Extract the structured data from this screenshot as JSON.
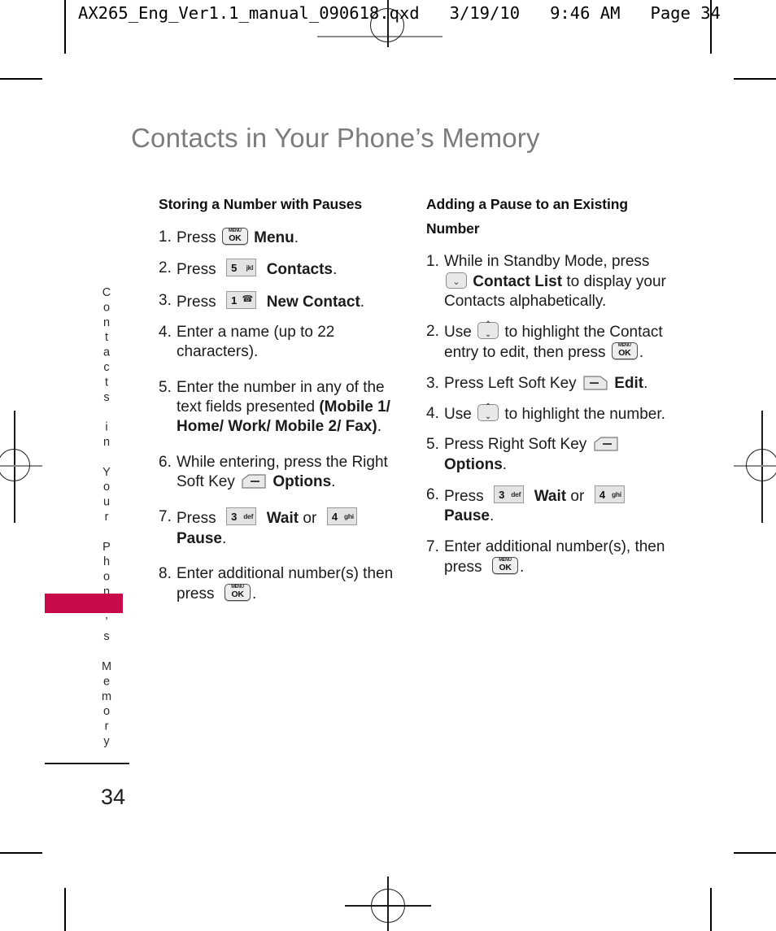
{
  "print_header": {
    "text": "AX265_Eng_Ver1.1_manual_090618.qxd   3/19/10   9:46 AM   Page 34"
  },
  "page": {
    "title": "Contacts in Your Phone’s Memory",
    "side_tab": "Contacts in Your Phone’s Memory",
    "number": "34",
    "accent_color": "#c80a4b",
    "title_color": "#7c7c7c"
  },
  "left_column": {
    "heading": "Storing a Number with Pauses",
    "steps": [
      {
        "num": "1.",
        "pre": "Press",
        "key": "menu-ok",
        "post_bold": "Menu",
        "post": "."
      },
      {
        "num": "2.",
        "pre": "Press",
        "key": "5-jkl",
        "post_bold": "Contacts",
        "post": "."
      },
      {
        "num": "3.",
        "pre": "Press",
        "key": "1-voicemail",
        "post_bold": "New Contact",
        "post": "."
      },
      {
        "num": "4.",
        "text": "Enter a name (up to 22 characters)."
      },
      {
        "num": "5.",
        "text_a": "Enter the number in any of the text fields presented ",
        "text_b": "(Mobile 1/ Home/ Work/ Mobile 2/ Fax)",
        "text_c": "."
      },
      {
        "num": "6.",
        "pre": "While entering, press the Right Soft Key",
        "key": "right-soft-key",
        "post_bold": "Options",
        "post": "."
      },
      {
        "num": "7.",
        "pre": "Press",
        "key": "3-def",
        "mid_bold": "Wait",
        "mid": "or",
        "key2": "4-ghi",
        "post_bold": "Pause",
        "post": "."
      },
      {
        "num": "8.",
        "pre": "Enter additional number(s) then press",
        "key": "menu-ok",
        "post": "."
      }
    ]
  },
  "right_column": {
    "heading": "Adding a Pause to an Existing Number",
    "steps": [
      {
        "num": "1.",
        "pre": "While in Standby Mode, press",
        "key": "down-arrow",
        "post_bold": "Contact List",
        "post": " to display your Contacts alphabetically."
      },
      {
        "num": "2.",
        "pre": "Use",
        "key": "up-down-arrow",
        "mid": "to highlight the Contact entry to edit, then press",
        "key2": "menu-ok",
        "post": "."
      },
      {
        "num": "3.",
        "pre": "Press Left Soft Key",
        "key": "left-soft-key",
        "post_bold": "Edit",
        "post": "."
      },
      {
        "num": "4.",
        "pre": "Use",
        "key": "up-down-arrow",
        "mid": "to highlight the number.",
        "post": ""
      },
      {
        "num": "5.",
        "pre": "Press Right Soft Key",
        "key": "right-soft-key",
        "post_bold": "Options",
        "post": "."
      },
      {
        "num": "6.",
        "pre": "Press",
        "key": "3-def",
        "mid_bold": "Wait",
        "mid": "or",
        "key2": "4-ghi",
        "post_bold": "Pause",
        "post": "."
      },
      {
        "num": "7.",
        "pre": "Enter additional number(s), then press",
        "key": "menu-ok",
        "post": "."
      }
    ]
  },
  "keys": {
    "menu_ok": {
      "top": "MENU",
      "bottom": "OK"
    },
    "k5": {
      "digit": "5",
      "letters": "jkl"
    },
    "k1": {
      "digit": "1",
      "letters": "☎"
    },
    "k3": {
      "digit": "3",
      "letters": "def"
    },
    "k4": {
      "digit": "4",
      "letters": "ghi"
    },
    "nav_up": "▲",
    "nav_down": "▼"
  }
}
